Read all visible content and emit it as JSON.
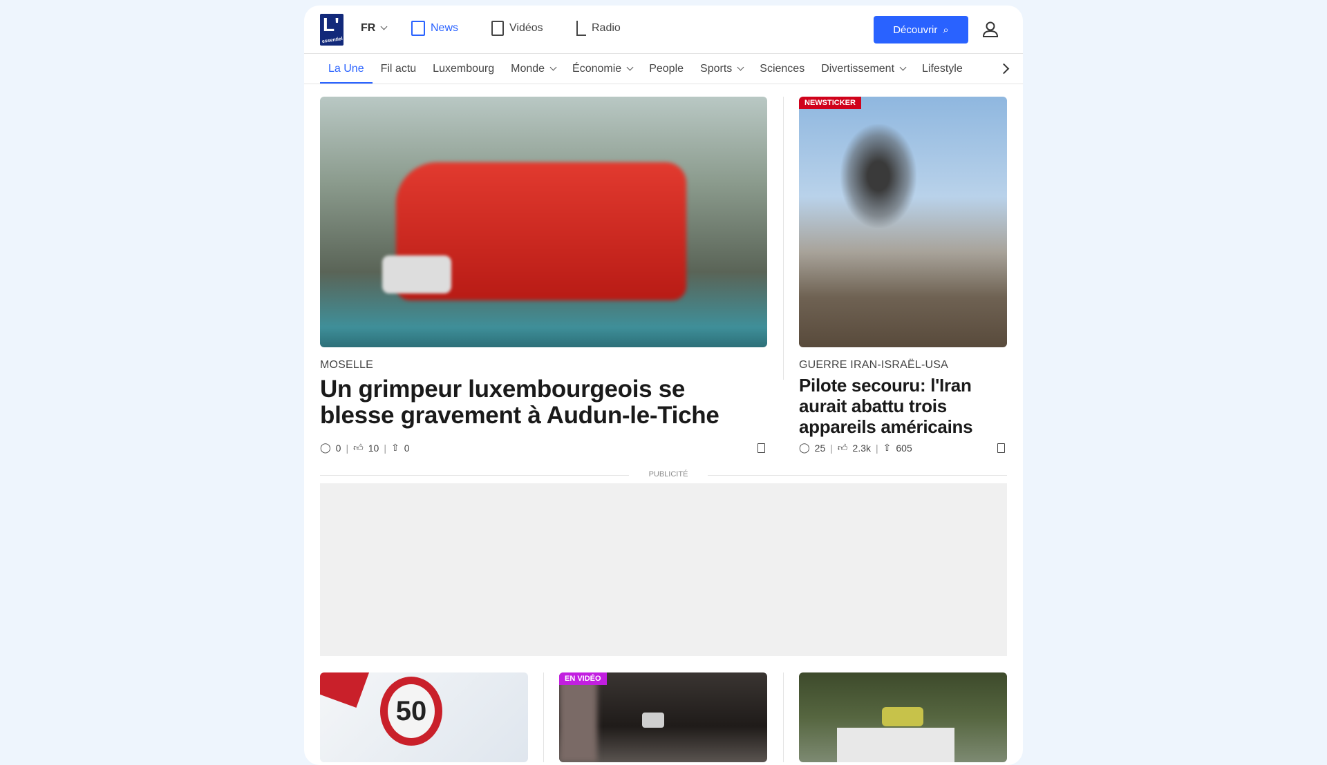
{
  "header": {
    "logo": "L' essentiel",
    "lang": "FR",
    "nav": [
      {
        "label": "News",
        "icon": "newspaper-icon"
      },
      {
        "label": "Vidéos",
        "icon": "play-icon"
      },
      {
        "label": "Radio",
        "icon": "radio-icon"
      }
    ],
    "discover": "Découvrir"
  },
  "subnav": [
    "La Une",
    "Fil actu",
    "Luxembourg",
    "Monde",
    "Économie",
    "People",
    "Sports",
    "Sciences",
    "Divertissement",
    "Lifestyle"
  ],
  "main": {
    "category": "MOSELLE",
    "title": "Un grimpeur luxembourgeois se blesse gravement à Audun-le-Tiche",
    "comments": "0",
    "likes": "10",
    "shares": "0"
  },
  "side": {
    "badge": "NEWSTICKER",
    "category": "GUERRE IRAN-ISRAËL-USA",
    "title": "Pilote secouru: l'Iran aurait abattu trois appareils américains",
    "comments": "25",
    "likes": "2.3k",
    "shares": "605"
  },
  "ad_label": "PUBLICITÉ",
  "bottom": {
    "video_badge": "EN VIDÉO",
    "sign": "50"
  },
  "colors": {
    "accent": "#2962ff",
    "newsticker": "#d0021b",
    "video": "#c21fe0"
  }
}
